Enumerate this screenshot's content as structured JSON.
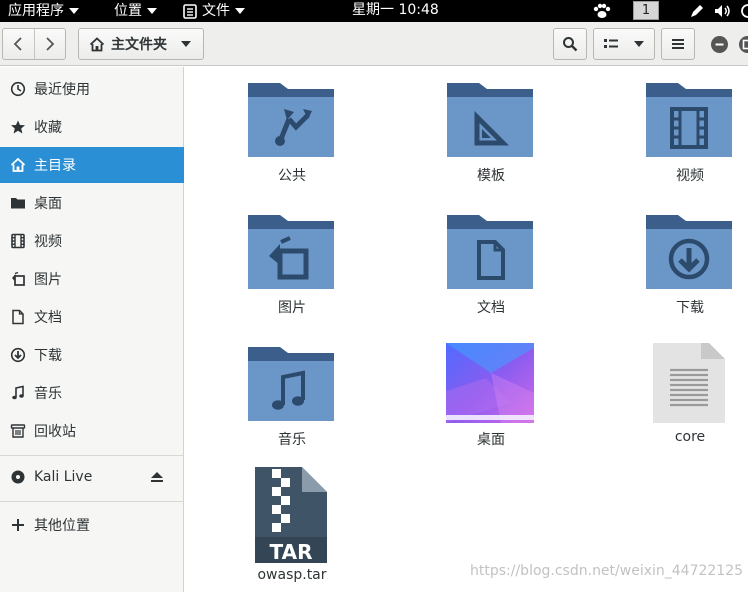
{
  "topbar": {
    "apps_menu": "应用程序",
    "places_menu": "位置",
    "files_menu": "文件",
    "clock": "星期一 10:48",
    "workspace": "1"
  },
  "toolbar": {
    "back_icon": "chevron-left-icon",
    "forward_icon": "chevron-right-icon",
    "location_label": "主文件夹",
    "search_icon": "magnifier-icon",
    "view_icon": "list-view-icon",
    "menu_icon": "hamburger-icon"
  },
  "sidebar": {
    "items": [
      {
        "label": "最近使用",
        "icon": "clock-icon"
      },
      {
        "label": "收藏",
        "icon": "star-icon"
      },
      {
        "label": "主目录",
        "icon": "home-icon",
        "active": true
      },
      {
        "label": "桌面",
        "icon": "folder-icon"
      },
      {
        "label": "视频",
        "icon": "film-icon"
      },
      {
        "label": "图片",
        "icon": "image-icon"
      },
      {
        "label": "文档",
        "icon": "document-icon"
      },
      {
        "label": "下载",
        "icon": "download-icon"
      },
      {
        "label": "音乐",
        "icon": "music-icon"
      },
      {
        "label": "回收站",
        "icon": "trash-icon"
      }
    ],
    "device": {
      "label": "Kali Live",
      "icon": "disc-icon",
      "eject_icon": "eject-icon"
    },
    "other": {
      "label": "其他位置",
      "icon": "plus-icon"
    }
  },
  "files": [
    {
      "name": "公共",
      "icon": "share-folder-icon"
    },
    {
      "name": "模板",
      "icon": "templates-folder-icon"
    },
    {
      "name": "视频",
      "icon": "videos-folder-icon"
    },
    {
      "name": "图片",
      "icon": "pictures-folder-icon"
    },
    {
      "name": "文档",
      "icon": "documents-folder-icon"
    },
    {
      "name": "下载",
      "icon": "downloads-folder-icon"
    },
    {
      "name": "音乐",
      "icon": "music-folder-icon"
    },
    {
      "name": "桌面",
      "icon": "desktop-thumbnail-icon"
    },
    {
      "name": "core",
      "icon": "text-file-icon"
    },
    {
      "name": "owasp.tar",
      "icon": "tar-archive-icon",
      "badge": "TAR"
    }
  ],
  "watermark": "https://blog.csdn.net/weixin_44722125",
  "colors": {
    "accent": "#2a8fd5",
    "folder_back": "#3b5f8a",
    "folder_front": "#6b96c8",
    "folder_glyph": "#2c4a6b",
    "tar_dark": "#3f5466"
  }
}
